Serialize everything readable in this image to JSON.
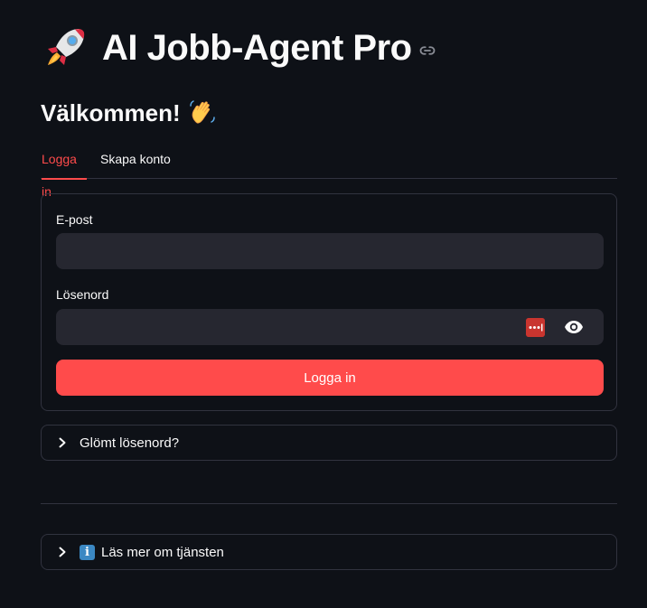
{
  "header": {
    "title": "AI Jobb-Agent Pro"
  },
  "welcome": {
    "text": "Välkommen!"
  },
  "tabs": [
    {
      "label": "Logga in",
      "active": true
    },
    {
      "label": "Skapa konto",
      "active": false
    }
  ],
  "login_form": {
    "email_label": "E-post",
    "email_value": "",
    "password_label": "Lösenord",
    "password_value": "",
    "submit_label": "Logga in"
  },
  "expanders": {
    "forgot_label": "Glömt lösenord?",
    "info_label": "Läs mer om tjänsten",
    "info_icon_glyph": "i"
  },
  "colors": {
    "accent": "#ff4b4b",
    "background": "#0e1117",
    "input_bg": "#262730",
    "border": "#31333f"
  },
  "icons": [
    "rocket-icon",
    "link-icon",
    "waving-hand-icon",
    "password-manager-icon",
    "eye-icon",
    "chevron-right-icon",
    "information-icon"
  ]
}
